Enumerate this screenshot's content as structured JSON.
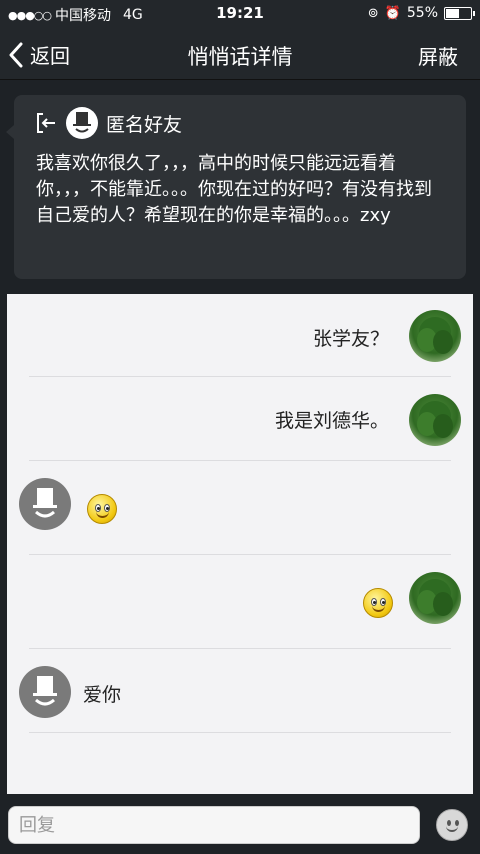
{
  "status_bar": {
    "signal": "●●●○○",
    "carrier": "中国移动",
    "network": "4G",
    "time": "19:21",
    "battery": "55%",
    "battery_level": 0.55
  },
  "nav": {
    "back_label": "返回",
    "title": "悄悄话详情",
    "right_label": "屏蔽"
  },
  "card": {
    "sender": "匿名好友",
    "text": "我喜欢你很久了，，，高中的时候只能远远看着你，，，不能靠近。。。你现在过的好吗？有没有找到自己爱的人？希望现在的你是幸福的。。。zxy"
  },
  "messages": [
    {
      "side": "right",
      "type": "text",
      "text": "张学友？"
    },
    {
      "side": "right",
      "type": "text",
      "text": "我是刘德华。"
    },
    {
      "side": "left",
      "type": "emoji",
      "emoji": "smiley-icon"
    },
    {
      "side": "right",
      "type": "emoji",
      "emoji": "smiley-icon"
    },
    {
      "side": "left",
      "type": "text",
      "text": "爱你"
    }
  ],
  "input": {
    "placeholder": "回复"
  },
  "colors": {
    "bar_bg": "#23272b",
    "card_bg": "#2e3236",
    "chat_bg": "#f3f3f5"
  }
}
